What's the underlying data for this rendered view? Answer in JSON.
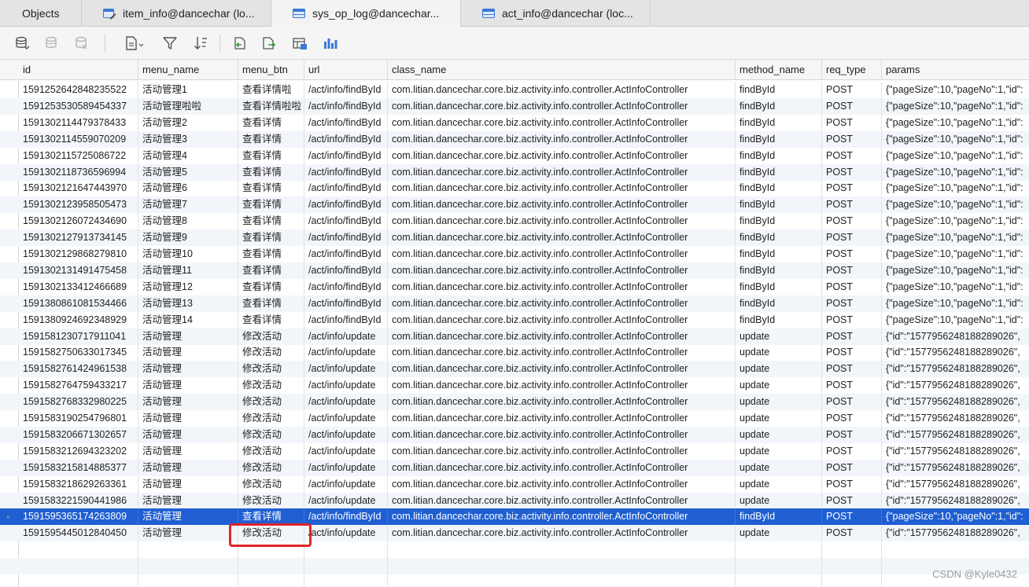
{
  "tabs": [
    {
      "label": "Objects",
      "icon": "none"
    },
    {
      "label": "item_info@dancechar (lo...",
      "icon": "table-edit-icon"
    },
    {
      "label": "sys_op_log@dancechar...",
      "icon": "table-icon"
    },
    {
      "label": "act_info@dancechar (loc...",
      "icon": "table-icon"
    }
  ],
  "active_tab": 2,
  "toolbar": {
    "buttons": [
      "begin-transaction-icon",
      "commit-icon",
      "rollback-icon",
      "text-view-icon",
      "filter-icon",
      "sort-icon",
      "import-icon",
      "export-icon",
      "data-generation-icon",
      "chart-icon"
    ]
  },
  "columns": [
    "id",
    "menu_name",
    "menu_btn",
    "url",
    "class_name",
    "method_name",
    "req_type",
    "params"
  ],
  "rows": [
    [
      "1591252642848235522",
      "活动管理1",
      "查看详情啦",
      "/act/info/findById",
      "com.litian.dancechar.core.biz.activity.info.controller.ActInfoController",
      "findById",
      "POST",
      "{\"pageSize\":10,\"pageNo\":1,\"id\":"
    ],
    [
      "1591253530589454337",
      "活动管理啦啦",
      "查看详情啦啦",
      "/act/info/findById",
      "com.litian.dancechar.core.biz.activity.info.controller.ActInfoController",
      "findById",
      "POST",
      "{\"pageSize\":10,\"pageNo\":1,\"id\":"
    ],
    [
      "1591302114479378433",
      "活动管理2",
      "查看详情",
      "/act/info/findById",
      "com.litian.dancechar.core.biz.activity.info.controller.ActInfoController",
      "findById",
      "POST",
      "{\"pageSize\":10,\"pageNo\":1,\"id\":"
    ],
    [
      "1591302114559070209",
      "活动管理3",
      "查看详情",
      "/act/info/findById",
      "com.litian.dancechar.core.biz.activity.info.controller.ActInfoController",
      "findById",
      "POST",
      "{\"pageSize\":10,\"pageNo\":1,\"id\":"
    ],
    [
      "1591302115725086722",
      "活动管理4",
      "查看详情",
      "/act/info/findById",
      "com.litian.dancechar.core.biz.activity.info.controller.ActInfoController",
      "findById",
      "POST",
      "{\"pageSize\":10,\"pageNo\":1,\"id\":"
    ],
    [
      "1591302118736596994",
      "活动管理5",
      "查看详情",
      "/act/info/findById",
      "com.litian.dancechar.core.biz.activity.info.controller.ActInfoController",
      "findById",
      "POST",
      "{\"pageSize\":10,\"pageNo\":1,\"id\":"
    ],
    [
      "1591302121647443970",
      "活动管理6",
      "查看详情",
      "/act/info/findById",
      "com.litian.dancechar.core.biz.activity.info.controller.ActInfoController",
      "findById",
      "POST",
      "{\"pageSize\":10,\"pageNo\":1,\"id\":"
    ],
    [
      "1591302123958505473",
      "活动管理7",
      "查看详情",
      "/act/info/findById",
      "com.litian.dancechar.core.biz.activity.info.controller.ActInfoController",
      "findById",
      "POST",
      "{\"pageSize\":10,\"pageNo\":1,\"id\":"
    ],
    [
      "1591302126072434690",
      "活动管理8",
      "查看详情",
      "/act/info/findById",
      "com.litian.dancechar.core.biz.activity.info.controller.ActInfoController",
      "findById",
      "POST",
      "{\"pageSize\":10,\"pageNo\":1,\"id\":"
    ],
    [
      "1591302127913734145",
      "活动管理9",
      "查看详情",
      "/act/info/findById",
      "com.litian.dancechar.core.biz.activity.info.controller.ActInfoController",
      "findById",
      "POST",
      "{\"pageSize\":10,\"pageNo\":1,\"id\":"
    ],
    [
      "1591302129868279810",
      "活动管理10",
      "查看详情",
      "/act/info/findById",
      "com.litian.dancechar.core.biz.activity.info.controller.ActInfoController",
      "findById",
      "POST",
      "{\"pageSize\":10,\"pageNo\":1,\"id\":"
    ],
    [
      "1591302131491475458",
      "活动管理11",
      "查看详情",
      "/act/info/findById",
      "com.litian.dancechar.core.biz.activity.info.controller.ActInfoController",
      "findById",
      "POST",
      "{\"pageSize\":10,\"pageNo\":1,\"id\":"
    ],
    [
      "1591302133412466689",
      "活动管理12",
      "查看详情",
      "/act/info/findById",
      "com.litian.dancechar.core.biz.activity.info.controller.ActInfoController",
      "findById",
      "POST",
      "{\"pageSize\":10,\"pageNo\":1,\"id\":"
    ],
    [
      "1591380861081534466",
      "活动管理13",
      "查看详情",
      "/act/info/findById",
      "com.litian.dancechar.core.biz.activity.info.controller.ActInfoController",
      "findById",
      "POST",
      "{\"pageSize\":10,\"pageNo\":1,\"id\":"
    ],
    [
      "1591380924692348929",
      "活动管理14",
      "查看详情",
      "/act/info/findById",
      "com.litian.dancechar.core.biz.activity.info.controller.ActInfoController",
      "findById",
      "POST",
      "{\"pageSize\":10,\"pageNo\":1,\"id\":"
    ],
    [
      "1591581230717911041",
      "活动管理",
      "修改活动",
      "/act/info/update",
      "com.litian.dancechar.core.biz.activity.info.controller.ActInfoController",
      "update",
      "POST",
      "{\"id\":\"1577956248188289026\","
    ],
    [
      "1591582750633017345",
      "活动管理",
      "修改活动",
      "/act/info/update",
      "com.litian.dancechar.core.biz.activity.info.controller.ActInfoController",
      "update",
      "POST",
      "{\"id\":\"1577956248188289026\","
    ],
    [
      "1591582761424961538",
      "活动管理",
      "修改活动",
      "/act/info/update",
      "com.litian.dancechar.core.biz.activity.info.controller.ActInfoController",
      "update",
      "POST",
      "{\"id\":\"1577956248188289026\","
    ],
    [
      "1591582764759433217",
      "活动管理",
      "修改活动",
      "/act/info/update",
      "com.litian.dancechar.core.biz.activity.info.controller.ActInfoController",
      "update",
      "POST",
      "{\"id\":\"1577956248188289026\","
    ],
    [
      "1591582768332980225",
      "活动管理",
      "修改活动",
      "/act/info/update",
      "com.litian.dancechar.core.biz.activity.info.controller.ActInfoController",
      "update",
      "POST",
      "{\"id\":\"1577956248188289026\","
    ],
    [
      "1591583190254796801",
      "活动管理",
      "修改活动",
      "/act/info/update",
      "com.litian.dancechar.core.biz.activity.info.controller.ActInfoController",
      "update",
      "POST",
      "{\"id\":\"1577956248188289026\","
    ],
    [
      "1591583206671302657",
      "活动管理",
      "修改活动",
      "/act/info/update",
      "com.litian.dancechar.core.biz.activity.info.controller.ActInfoController",
      "update",
      "POST",
      "{\"id\":\"1577956248188289026\","
    ],
    [
      "1591583212694323202",
      "活动管理",
      "修改活动",
      "/act/info/update",
      "com.litian.dancechar.core.biz.activity.info.controller.ActInfoController",
      "update",
      "POST",
      "{\"id\":\"1577956248188289026\","
    ],
    [
      "1591583215814885377",
      "活动管理",
      "修改活动",
      "/act/info/update",
      "com.litian.dancechar.core.biz.activity.info.controller.ActInfoController",
      "update",
      "POST",
      "{\"id\":\"1577956248188289026\","
    ],
    [
      "1591583218629263361",
      "活动管理",
      "修改活动",
      "/act/info/update",
      "com.litian.dancechar.core.biz.activity.info.controller.ActInfoController",
      "update",
      "POST",
      "{\"id\":\"1577956248188289026\","
    ],
    [
      "1591583221590441986",
      "活动管理",
      "修改活动",
      "/act/info/update",
      "com.litian.dancechar.core.biz.activity.info.controller.ActInfoController",
      "update",
      "POST",
      "{\"id\":\"1577956248188289026\","
    ],
    [
      "1591595365174263809",
      "活动管理",
      "查看详情",
      "/act/info/findById",
      "com.litian.dancechar.core.biz.activity.info.controller.ActInfoController",
      "findById",
      "POST",
      "{\"pageSize\":10,\"pageNo\":1,\"id\":"
    ],
    [
      "1591595445012840450",
      "活动管理",
      "修改活动",
      "/act/info/update",
      "com.litian.dancechar.core.biz.activity.info.controller.ActInfoController",
      "update",
      "POST",
      "{\"id\":\"1577956248188289026\","
    ]
  ],
  "selected_row": 26,
  "current_row_marker": "▸",
  "watermark": "CSDN @Kyle0432",
  "colors": {
    "selection": "#1f5fd1",
    "highlight_box": "#e0242a",
    "alt_row": "#f2f5fa"
  }
}
